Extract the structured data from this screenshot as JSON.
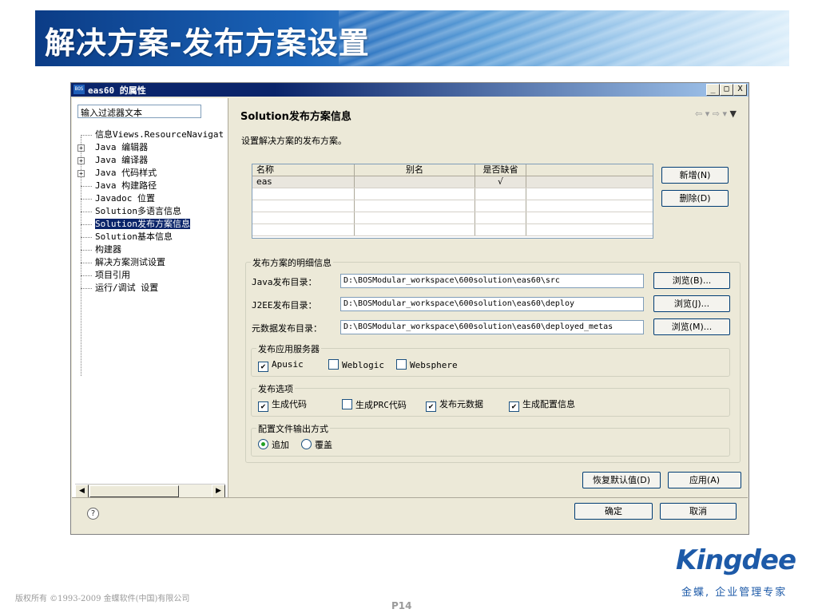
{
  "slide": {
    "title": "解决方案-发布方案设置",
    "copyright": "版权所有 ©1993-2009 金蝶软件(中国)有限公司",
    "page_number": "P14",
    "brand": "Kingdee",
    "slogan": "金蝶, 企业管理专家"
  },
  "window": {
    "logo": "BOS",
    "title": "eas60 的属性",
    "controls": [
      "_",
      "□",
      "X"
    ]
  },
  "sidebar": {
    "filter_placeholder": "输入过滤器文本",
    "items": [
      {
        "label": "信息Views.ResourceNavigat",
        "expandable": false
      },
      {
        "label": "Java 编辑器",
        "expandable": true
      },
      {
        "label": "Java 编译器",
        "expandable": true
      },
      {
        "label": "Java 代码样式",
        "expandable": true
      },
      {
        "label": "Java 构建路径",
        "expandable": false
      },
      {
        "label": "Javadoc 位置",
        "expandable": false
      },
      {
        "label": "Solution多语言信息",
        "expandable": false
      },
      {
        "label": "Solution发布方案信息",
        "expandable": false,
        "selected": true
      },
      {
        "label": "Solution基本信息",
        "expandable": false
      },
      {
        "label": "构建器",
        "expandable": false
      },
      {
        "label": "解决方案测试设置",
        "expandable": false
      },
      {
        "label": "项目引用",
        "expandable": false
      },
      {
        "label": "运行/调试 设置",
        "expandable": false
      }
    ]
  },
  "page": {
    "title": "Solution发布方案信息",
    "description": "设置解决方案的发布方案。",
    "table": {
      "columns": [
        "名称",
        "别名",
        "是否缺省",
        ""
      ],
      "rows": [
        [
          "eas",
          "",
          "√",
          ""
        ]
      ]
    },
    "buttons": {
      "add": "新增(N)",
      "delete": "删除(D)",
      "restore_defaults": "恢复默认值(D)",
      "apply": "应用(A)",
      "ok": "确定",
      "cancel": "取消"
    },
    "detail_group": "发布方案的明细信息",
    "fields": [
      {
        "label": "Java发布目录：",
        "value": "D:\\BOSModular_workspace\\600solution\\eas60\\src",
        "browse": "浏览(B)..."
      },
      {
        "label": "J2EE发布目录：",
        "value": "D:\\BOSModular_workspace\\600solution\\eas60\\deploy",
        "browse": "浏览(J)..."
      },
      {
        "label": "元数据发布目录：",
        "value": "D:\\BOSModular_workspace\\600solution\\eas60\\deployed_metas",
        "browse": "浏览(M)..."
      }
    ],
    "server_group": "发布应用服务器",
    "servers": [
      {
        "label": "Apusic",
        "checked": true
      },
      {
        "label": "Weblogic",
        "checked": false
      },
      {
        "label": "Websphere",
        "checked": false
      }
    ],
    "options_group": "发布选项",
    "options": [
      {
        "label": "生成代码",
        "checked": true
      },
      {
        "label": "生成PRC代码",
        "checked": false
      },
      {
        "label": "发布元数据",
        "checked": true
      },
      {
        "label": "生成配置信息",
        "checked": true
      }
    ],
    "config_group": "配置文件输出方式",
    "config_modes": [
      {
        "label": "追加",
        "selected": true
      },
      {
        "label": "覆盖",
        "selected": false
      }
    ]
  }
}
